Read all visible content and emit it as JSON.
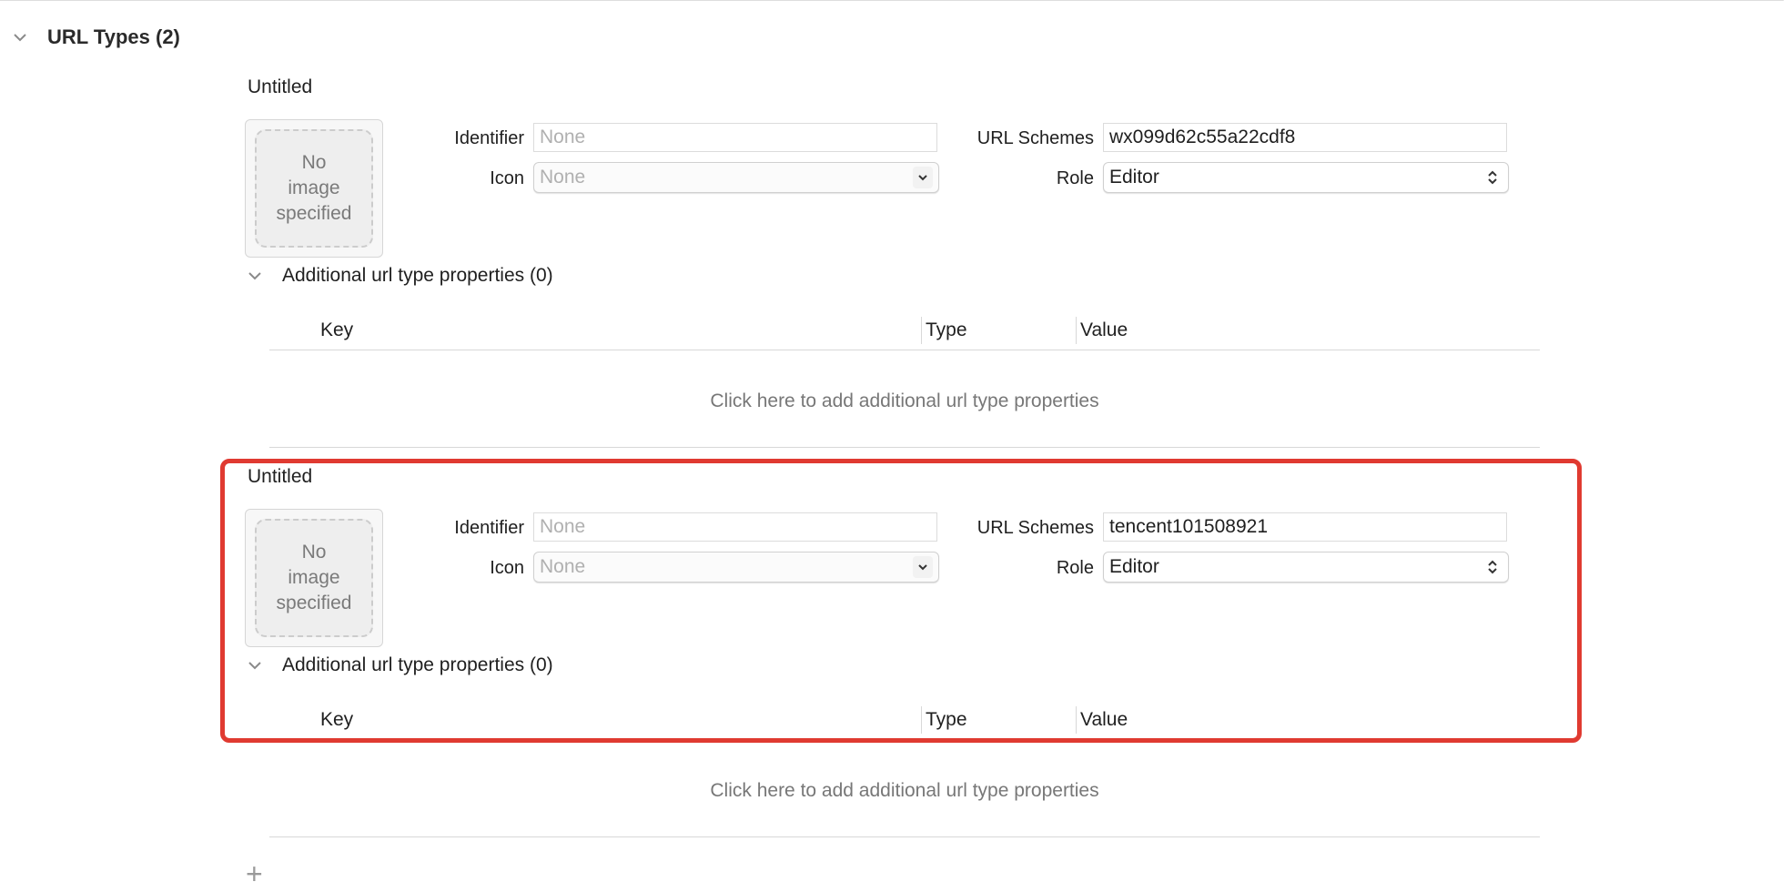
{
  "section": {
    "title": "URL Types (2)"
  },
  "labels": {
    "identifier": "Identifier",
    "icon": "Icon",
    "url_schemes": "URL Schemes",
    "role": "Role"
  },
  "url_types": [
    {
      "title": "Untitled",
      "image_placeholder": "No\nimage\nspecified",
      "identifier_placeholder": "None",
      "icon_value": "None",
      "url_schemes": "wx099d62c55a22cdf8",
      "role": "Editor",
      "additional_title": "Additional url type properties (0)",
      "columns": {
        "key": "Key",
        "type": "Type",
        "value": "Value"
      },
      "add_hint": "Click here to add additional url type properties"
    },
    {
      "title": "Untitled",
      "image_placeholder": "No\nimage\nspecified",
      "identifier_placeholder": "None",
      "icon_value": "None",
      "url_schemes": "tencent101508921",
      "role": "Editor",
      "additional_title": "Additional url type properties (0)",
      "columns": {
        "key": "Key",
        "type": "Type",
        "value": "Value"
      },
      "add_hint": "Click here to add additional url type properties"
    }
  ],
  "add_button": "+",
  "colors": {
    "highlight": "#e03a31"
  }
}
